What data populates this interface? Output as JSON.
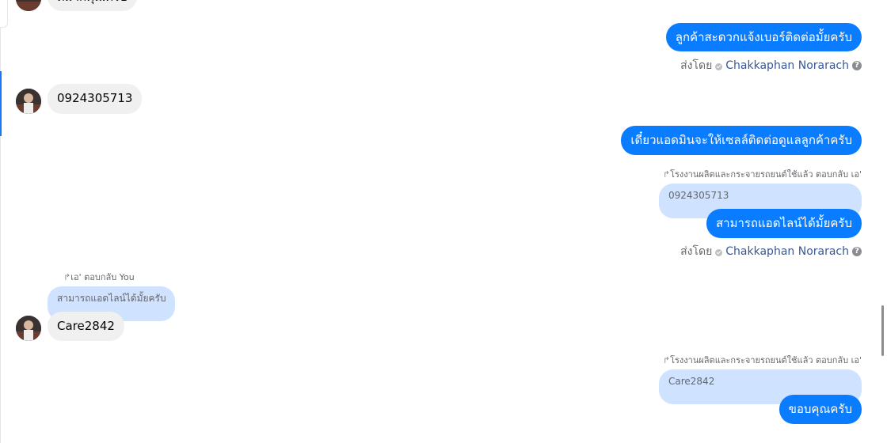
{
  "messages": {
    "partial_top": "ดีมากคุณครับ",
    "out1": "ลูกค้าสะดวกแจ้งเบอร์ติดต่อมั้ยครับ",
    "in_phone": "0924305713",
    "out2": "เดี๋ยวแอดมินจะให้เซลล์ติดต่อดูแลลูกค้าครับ",
    "out3": "สามารถแอดไลน์ได้มั้ยครับ",
    "in_line": "Care2842",
    "out4": "ขอบคุณครับ"
  },
  "sent_by": {
    "label": "ส่งโดย",
    "name": "Chakkaphan Norarach",
    "help_icon": "?"
  },
  "replies": {
    "r1_meta": "โรงงานผลิตและกระจายรถยนต์ใช้แล้ว ตอบกลับ เอ'",
    "r1_quote": "0924305713",
    "r2_meta": "เอ' ตอบกลับ You",
    "r2_quote": "สามารถแอดไลน์ได้มั้ยครับ",
    "r3_meta": "โรงงานผลิตและกระจายรถยนต์ใช้แล้ว ตอบกลับ เอ'",
    "r3_quote": "Care2842",
    "reply_icon": "↱"
  },
  "colors": {
    "outgoing_bubble": "#0a7cff",
    "incoming_bubble": "#f0f0f0",
    "quote_bubble": "#cfe2ff",
    "sender_link": "#385898"
  }
}
